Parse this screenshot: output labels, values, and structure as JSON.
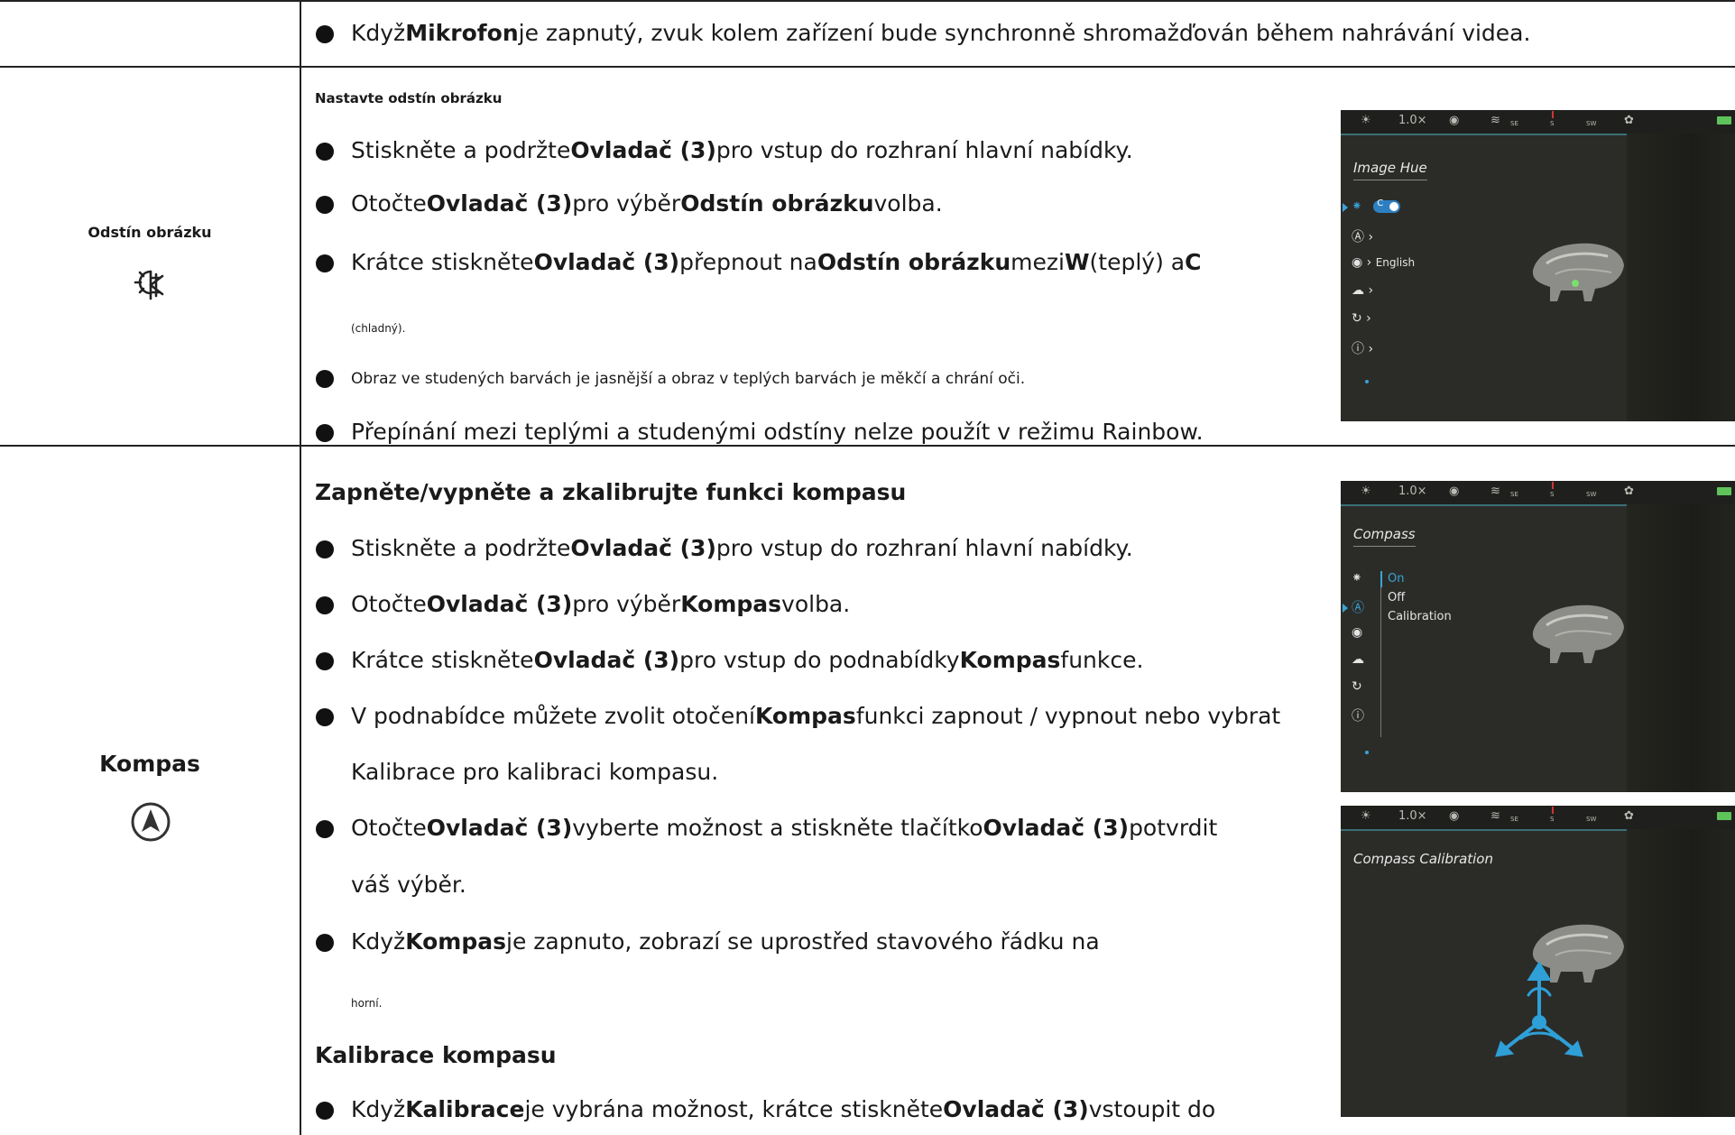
{
  "rows": {
    "mic": {
      "text_a": "Když",
      "text_b": "Mikrofon",
      "text_c": "je zapnutý, zvuk kolem zařízení bude synchronně shromažďován během nahrávání videa."
    },
    "hue": {
      "label": "Odstín obrázku",
      "heading": "Nastavte odstín obrázku",
      "b1_a": "Stiskněte a podržte",
      "b1_b": "Ovladač (3)",
      "b1_c": "pro vstup do rozhraní hlavní nabídky.",
      "b2_a": "Otočte",
      "b2_b": "Ovladač (3)",
      "b2_c": "pro výběr",
      "b2_d": "Odstín obrázku",
      "b2_e": "volba.",
      "b3_a": "Krátce stiskněte",
      "b3_b": "Ovladač (3)",
      "b3_c": "přepnout na",
      "b3_d": "Odstín obrázku",
      "b3_e": "mezi",
      "b3_f": "W",
      "b3_g": "(teplý) a",
      "b3_h": "C",
      "b3_cont": "(chladný).",
      "b4": "Obraz ve studených barvách je jasnější a obraz v teplých barvách je měkčí a chrání oči.",
      "b5": "Přepínání mezi teplými a studenými odstíny nelze použít v režimu Rainbow."
    },
    "compass": {
      "label": "Kompas",
      "heading": "Zapněte/vypněte a zkalibrujte funkci kompasu",
      "b1_a": "Stiskněte a podržte",
      "b1_b": "Ovladač (3)",
      "b1_c": "pro vstup do rozhraní hlavní nabídky.",
      "b2_a": "Otočte",
      "b2_b": "Ovladač (3)",
      "b2_c": "pro výběr",
      "b2_d": "Kompas",
      "b2_e": "volba.",
      "b3_a": "Krátce stiskněte",
      "b3_b": "Ovladač (3)",
      "b3_c": "pro vstup do podnabídky",
      "b3_d": "Kompas",
      "b3_e": "funkce.",
      "b4_a": "V podnabídce můžete zvolit otočení",
      "b4_b": "Kompas",
      "b4_c": "funkci zapnout / vypnout nebo vybrat",
      "b4_cont": "Kalibrace pro kalibraci kompasu.",
      "b5_a": "Otočte",
      "b5_b": "Ovladač (3)",
      "b5_c": "vyberte možnost a stiskněte tlačítko",
      "b5_d": "Ovladač (3)",
      "b5_e": "potvrdit",
      "b5_cont": "váš výběr.",
      "b6_a": "Když",
      "b6_b": "Kompas",
      "b6_c": "je zapnuto, zobrazí se uprostřed stavového řádku na",
      "b6_cont": "horní.",
      "heading2": "Kalibrace kompasu",
      "b7_a": "Když",
      "b7_b": "Kalibrace",
      "b7_c": "je vybrána možnost, krátce stiskněte",
      "b7_d": "Ovladač (3)",
      "b7_e": "vstoupit do"
    }
  },
  "screens": {
    "status": {
      "zoom": "1.0×",
      "compass_left": "SE",
      "compass_mid": "S",
      "compass_right": "SW"
    },
    "hue_screen": {
      "title": "Image Hue",
      "toggle": "C",
      "language": "English"
    },
    "compass_screen": {
      "title": "Compass",
      "options": [
        "On",
        "Off",
        "Calibration"
      ]
    },
    "calibration_screen": {
      "title": "Compass Calibration"
    }
  },
  "colors": {
    "accent": "#3aa3d8",
    "battery": "#5fc25a",
    "rule": "#222222"
  }
}
